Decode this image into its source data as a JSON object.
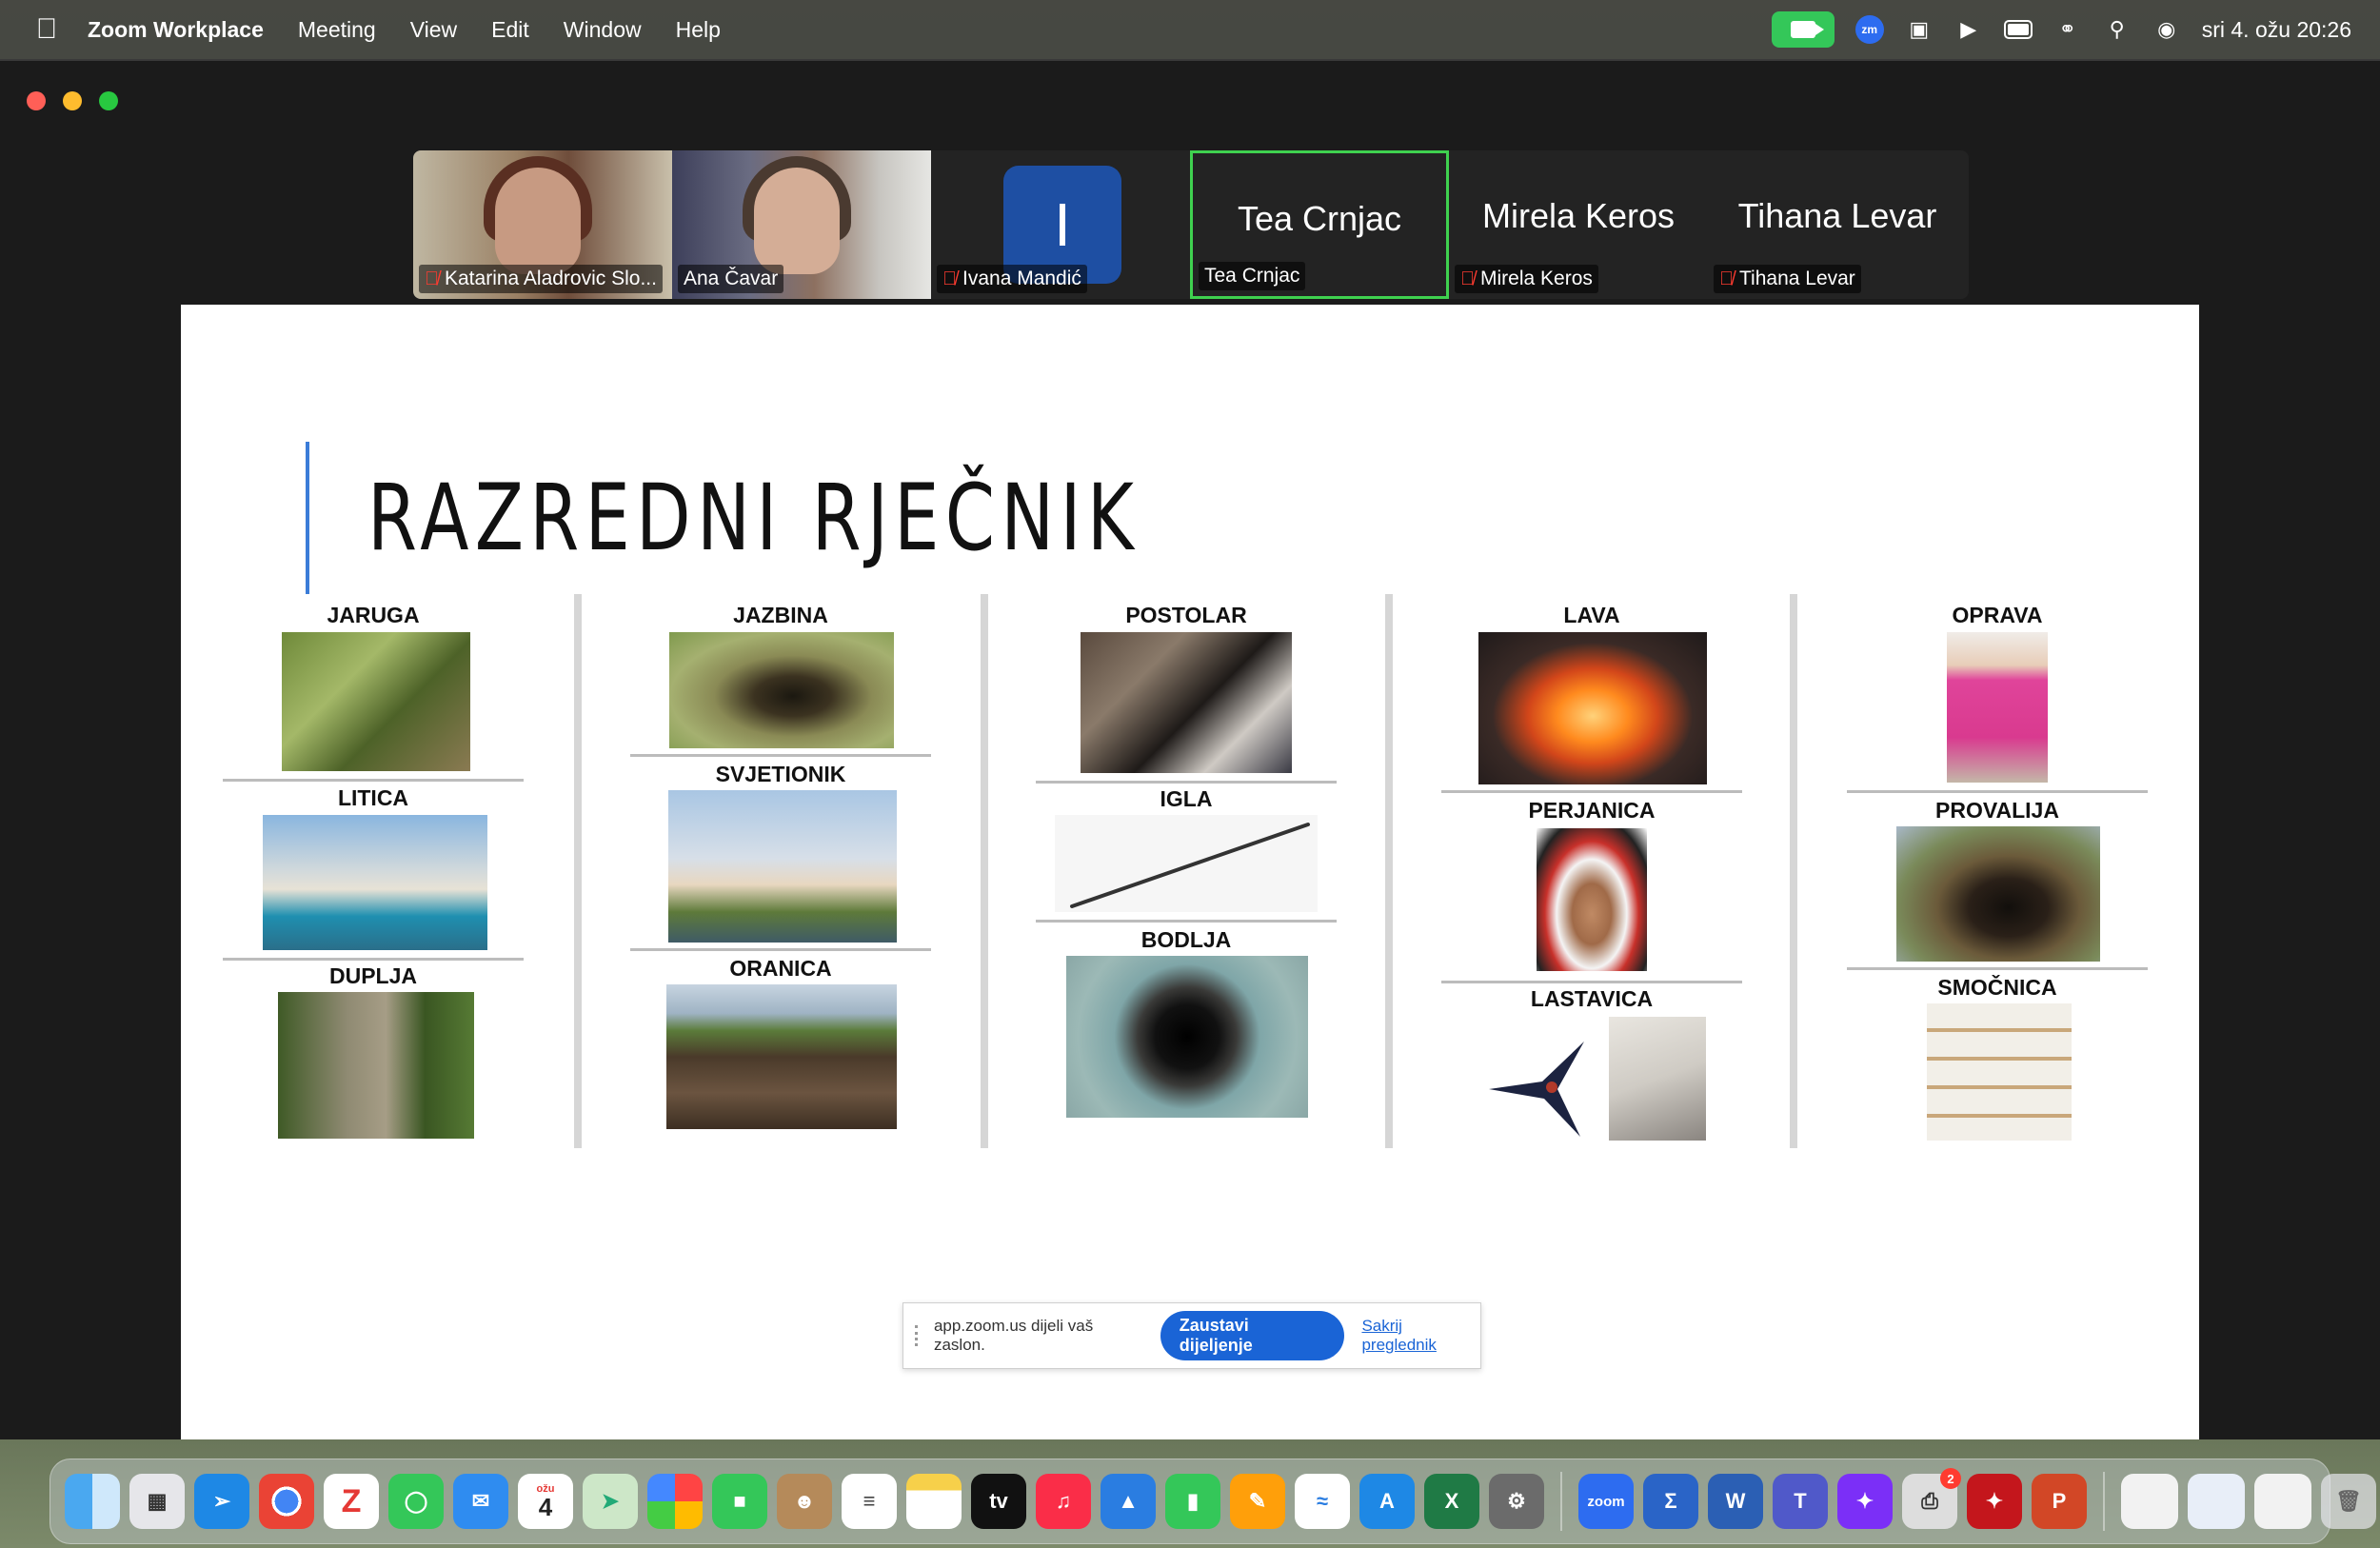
{
  "menubar": {
    "app_name": "Zoom Workplace",
    "items": [
      "Meeting",
      "View",
      "Edit",
      "Window",
      "Help"
    ],
    "datetime": "sri 4. ožu 20:26",
    "zoom_icon_text": "zm"
  },
  "participants": [
    {
      "name": "Katarina Aladrovic Slo...",
      "muted": true
    },
    {
      "name": "Ana Čavar",
      "muted": false
    },
    {
      "name": "Ivana Mandić",
      "muted": true,
      "avatar_letter": "I"
    },
    {
      "name": "Tea Crnjac",
      "muted": false,
      "big_name": "Tea Crnjac",
      "active": true
    },
    {
      "name": "Mirela Keros",
      "muted": true,
      "big_name": "Mirela Keros"
    },
    {
      "name": "Tihana Levar",
      "muted": true,
      "big_name": "Tihana Levar"
    }
  ],
  "slide": {
    "title": "RAZREDNI RJEČNIK",
    "words": {
      "jaruga": "JARUGA",
      "litica": "LITICA",
      "duplja": "DUPLJA",
      "jazbina": "JAZBINA",
      "svjetionik": "SVJETIONIK",
      "oranica": "ORANICA",
      "postolar": "POSTOLAR",
      "igla": "IGLA",
      "bodlja": "BODLJA",
      "lava": "LAVA",
      "perjanica": "PERJANICA",
      "lastavica": "LASTAVICA",
      "oprava": "OPRAVA",
      "provalija": "PROVALIJA",
      "smocnica": "SMOČNICA"
    }
  },
  "sharebar": {
    "message": "app.zoom.us dijeli vaš zaslon.",
    "stop_label": "Zaustavi dijeljenje",
    "hide_label": "Sakrij preglednik"
  },
  "dock": {
    "calendar_month": "ožu",
    "calendar_day": "4",
    "appletv_label": "tv",
    "zoom_label": "zoom",
    "printer_badge": "2"
  }
}
